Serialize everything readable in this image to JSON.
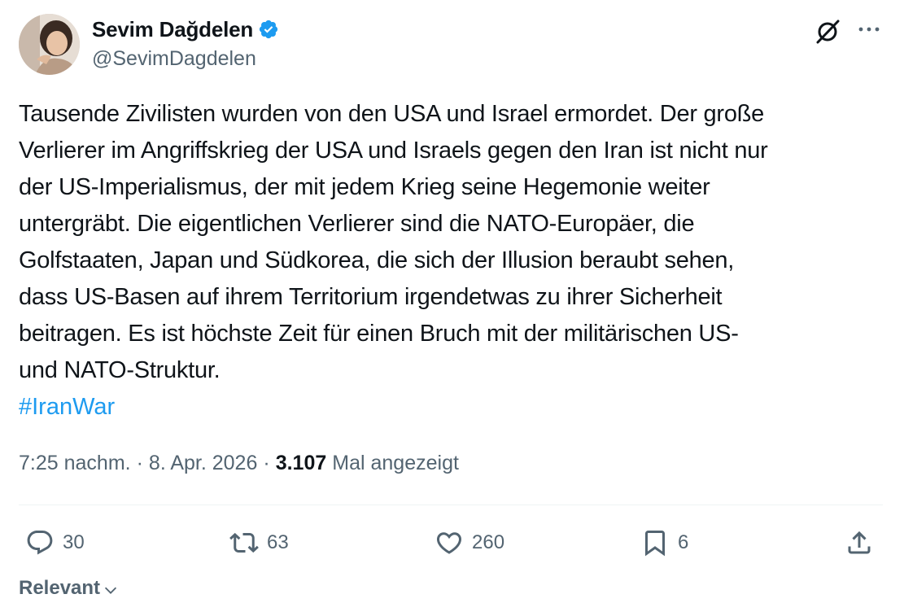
{
  "author": {
    "display_name": "Sevim Dağdelen",
    "handle": "@SevimDagdelen",
    "verified_icon": "verified-badge-icon",
    "verified_color": "#1d9bf0"
  },
  "tweet": {
    "text": "Tausende Zivilisten wurden von den USA und Israel ermordet. Der große\nVerlierer im Angriffskrieg der USA und Israels gegen den Iran ist nicht nur\nder US-Imperialismus, der mit jedem Krieg seine Hegemonie weiter\nuntergräbt. Die eigentlichen Verlierer sind die NATO-Europäer, die\nGolfstaaten, Japan und Südkorea, die sich der Illusion beraubt sehen,\ndass US-Basen auf ihrem Territorium irgendetwas zu ihrer Sicherheit\nbeitragen. Es ist höchste Zeit für einen Bruch mit der militärischen US-\nund NATO-Struktur.",
    "hashtag": "#IranWar",
    "hashtag_color": "#1d9bf0"
  },
  "meta": {
    "time": "7:25 nachm.",
    "separator": "·",
    "date": "8. Apr. 2026",
    "views_count": "3.107",
    "views_label": "Mal angezeigt"
  },
  "actions": {
    "reply_count": "30",
    "retweet_count": "63",
    "like_count": "260",
    "bookmark_count": "6"
  },
  "replies_filter": {
    "label": "Relevant"
  }
}
